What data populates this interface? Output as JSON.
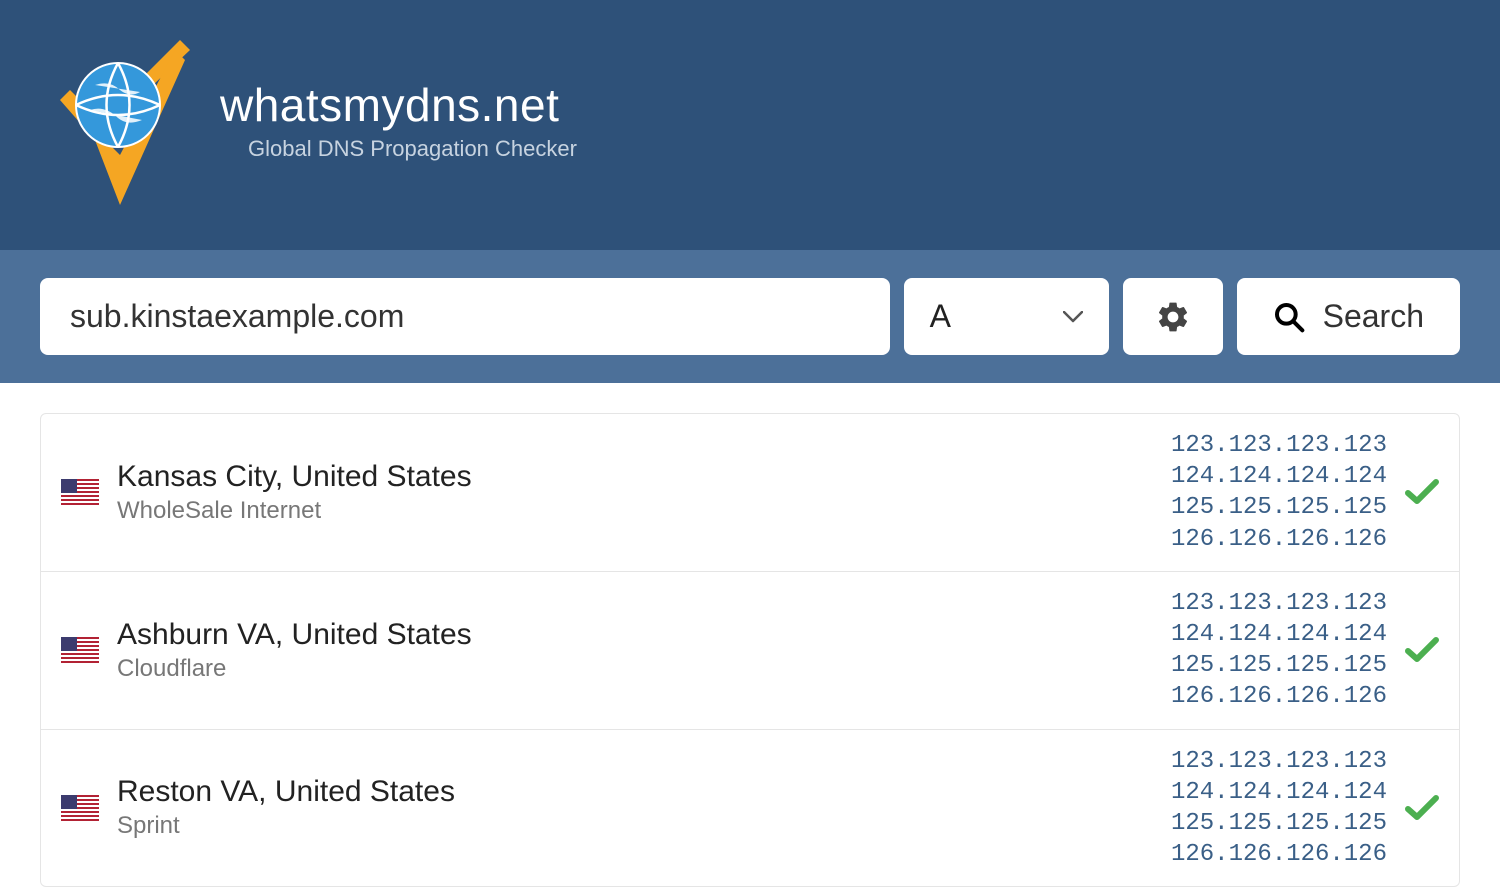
{
  "header": {
    "title": "whatsmydns.net",
    "subtitle": "Global DNS Propagation Checker"
  },
  "search": {
    "domain_value": "sub.kinstaexample.com",
    "record_type": "A",
    "search_label": "Search"
  },
  "results": [
    {
      "flag": "us",
      "location": "Kansas City, United States",
      "provider": "WholeSale Internet",
      "ips": [
        "123.123.123.123",
        "124.124.124.124",
        "125.125.125.125",
        "126.126.126.126"
      ],
      "status": "ok"
    },
    {
      "flag": "us",
      "location": "Ashburn VA, United States",
      "provider": "Cloudflare",
      "ips": [
        "123.123.123.123",
        "124.124.124.124",
        "125.125.125.125",
        "126.126.126.126"
      ],
      "status": "ok"
    },
    {
      "flag": "us",
      "location": "Reston VA, United States",
      "provider": "Sprint",
      "ips": [
        "123.123.123.123",
        "124.124.124.124",
        "125.125.125.125",
        "126.126.126.126"
      ],
      "status": "ok"
    }
  ]
}
